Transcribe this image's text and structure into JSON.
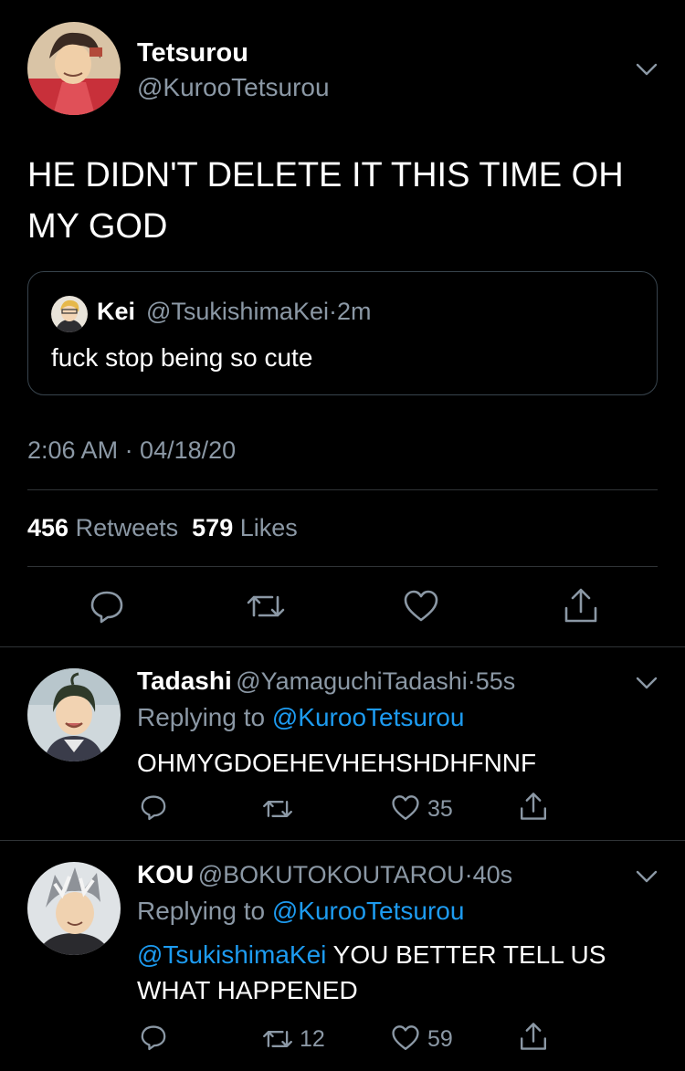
{
  "main_tweet": {
    "display_name": "Tetsurou",
    "handle": "@KurooTetsurou",
    "text": "HE DIDN'T DELETE IT THIS TIME OH MY GOD",
    "quote": {
      "display_name": "Kei",
      "handle": "@TsukishimaKei",
      "separator": "·",
      "time": "2m",
      "text": "fuck stop being so cute"
    },
    "timestamp": "2:06 AM · 04/18/20",
    "retweets_count": "456",
    "retweets_label": "Retweets",
    "likes_count": "579",
    "likes_label": "Likes"
  },
  "replies": [
    {
      "display_name": "Tadashi",
      "handle": "@YamaguchiTadashi",
      "time": "55s",
      "replying_prefix": "Replying to",
      "replying_handle": "@KurooTetsurou",
      "mention": "",
      "text": "OHMYGDOEHEVHEHSHDHFNNF",
      "retweets": "",
      "likes": "35"
    },
    {
      "display_name": "KOU",
      "handle": "@BOKUTOKOUTAROU",
      "time": "40s",
      "replying_prefix": "Replying to",
      "replying_handle": "@KurooTetsurou",
      "mention": "@TsukishimaKei",
      "text": "YOU BETTER TELL US WHAT HAPPENED",
      "retweets": "12",
      "likes": "59"
    }
  ],
  "icons": {
    "chevron": "chevron-down-icon",
    "reply": "reply-icon",
    "retweet": "retweet-icon",
    "like": "heart-icon",
    "share": "share-icon"
  },
  "colors": {
    "background": "#000000",
    "muted": "#8b98a5",
    "link": "#1d9bf0",
    "divider": "#2f3336"
  }
}
